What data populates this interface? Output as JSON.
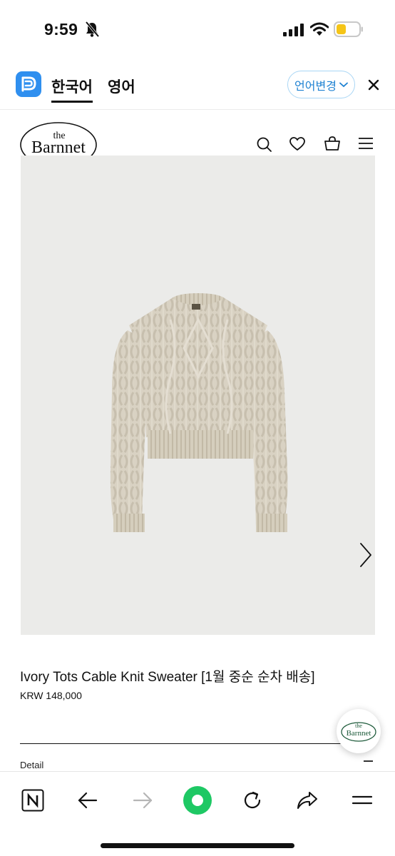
{
  "status_bar": {
    "time": "9:59",
    "icons": [
      "bell-slash-icon",
      "cellular-signal-icon",
      "wifi-icon",
      "battery-icon"
    ]
  },
  "translate_bar": {
    "tabs": [
      {
        "label": "한국어",
        "active": true
      },
      {
        "label": "영어",
        "active": false
      }
    ],
    "change_language_label": "언어변경",
    "close_icon": "close-icon",
    "accent_color": "#1f82d2"
  },
  "site_header": {
    "logo_text_small": "the",
    "logo_text": "Barnnet",
    "icons": [
      "search-icon",
      "heart-icon",
      "shopping-bag-icon",
      "menu-icon"
    ]
  },
  "product": {
    "image": "ivory-cable-knit-sweater-photo",
    "title": "Ivory Tots Cable Knit Sweater [1월 중순 순차 배송]",
    "price": "KRW 148,000",
    "detail_label": "Detail"
  },
  "floating_badge": {
    "small": "the",
    "text": "Barnnet"
  },
  "toolbar": {
    "buttons": [
      "naver-n-icon",
      "back-arrow-icon",
      "forward-arrow-icon",
      "green-dot-icon",
      "reload-icon",
      "share-icon",
      "menu-icon"
    ],
    "accent_color": "#1ec864"
  }
}
